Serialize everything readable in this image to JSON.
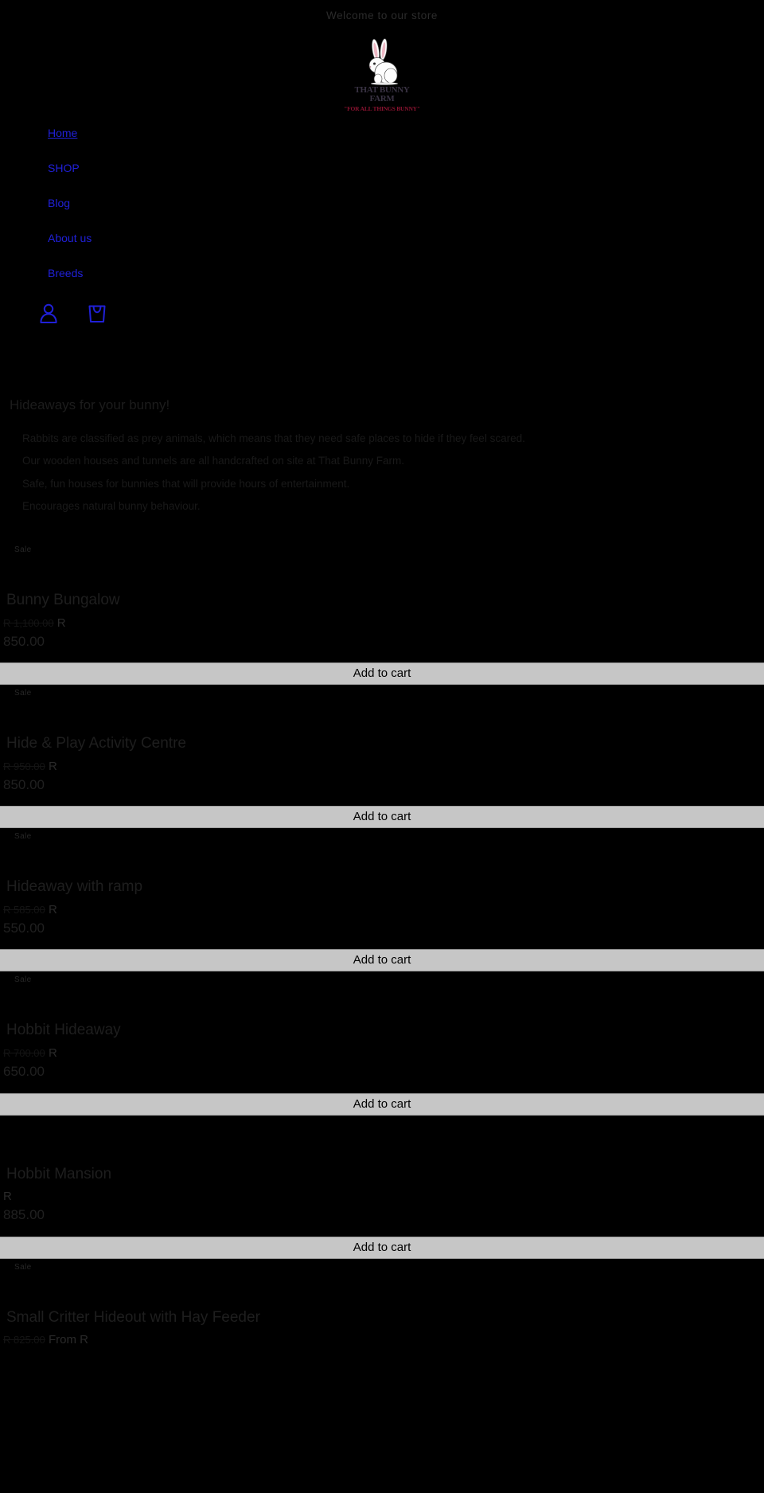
{
  "announcement": "Welcome to our store",
  "logo": {
    "icon": "bunny-icon",
    "wordmark": "THAT BUNNY FARM",
    "tagline": "\"FOR ALL THINGS BUNNY\"",
    "wordmark_color": "#3a3344",
    "tagline_color": "#8a1330"
  },
  "nav": {
    "items": [
      {
        "label": "Home",
        "name": "nav-item-home"
      },
      {
        "label": "SHOP",
        "name": "nav-item-shop"
      },
      {
        "label": "Blog",
        "name": "nav-item-blog"
      },
      {
        "label": "About us",
        "name": "nav-item-about-us"
      },
      {
        "label": "Breeds",
        "name": "nav-item-breeds"
      }
    ],
    "link_color": "#2020d8",
    "icons": [
      {
        "name": "account-icon",
        "label": "Account"
      },
      {
        "name": "cart-icon",
        "label": "Cart"
      }
    ]
  },
  "section": {
    "heading": "Hideaways for your bunny!",
    "paragraphs": [
      "Rabbits are classified as prey animals, which means that they need safe places to hide if they feel scared.",
      "Our wooden houses and tunnels are all handcrafted on site at That Bunny Farm.",
      "Safe, fun houses for bunnies that will provide hours of entertainment.",
      "Encourages natural bunny behaviour."
    ]
  },
  "add_to_cart_label": "Add to cart",
  "products": [
    {
      "badge": "Sale",
      "title": "Bunny Bungalow",
      "price_old": "R 1,100.00",
      "price_prefix": "R",
      "price_new": "850.00",
      "has_sale": true
    },
    {
      "badge": "Sale",
      "title": "Hide & Play Activity Centre",
      "price_old": "R 950.00",
      "price_prefix": "R",
      "price_new": "850.00",
      "has_sale": true
    },
    {
      "badge": "Sale",
      "title": "Hideaway with ramp",
      "price_old": "R 585.00",
      "price_prefix": "R",
      "price_new": "550.00",
      "has_sale": true
    },
    {
      "badge": "Sale",
      "title": "Hobbit Hideaway",
      "price_old": "R 700.00",
      "price_prefix": "R",
      "price_new": "650.00",
      "has_sale": true
    },
    {
      "badge": "",
      "title": "Hobbit Mansion",
      "price_old": "",
      "price_prefix": "R",
      "price_new": "885.00",
      "has_sale": false
    },
    {
      "badge": "Sale",
      "title": "Small Critter Hideout with Hay Feeder",
      "price_old": "R 825.00",
      "price_prefix": "From R",
      "price_new": "",
      "has_sale": true
    }
  ],
  "colors": {
    "background": "#000000",
    "link": "#2020d8",
    "button_bg": "#c6c6c6",
    "text": "#1a1a1a"
  }
}
